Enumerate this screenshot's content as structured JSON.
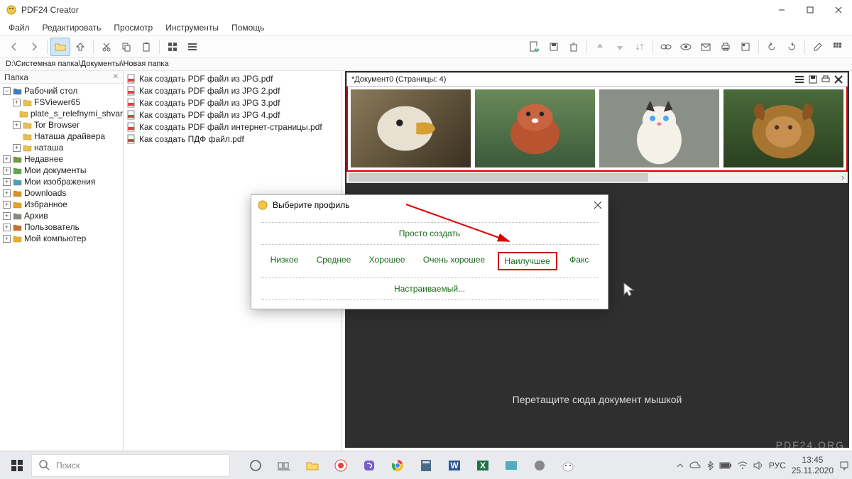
{
  "app": {
    "title": "PDF24 Creator"
  },
  "menu": {
    "file": "Файл",
    "edit": "Редактировать",
    "view": "Просмотр",
    "tools": "Инструменты",
    "help": "Помощь"
  },
  "path": "D:\\Системная папка\\Документы\\Новая папка",
  "left_pane": {
    "header": "Папка",
    "items": [
      {
        "label": "Рабочий стол",
        "expanded": true,
        "depth": 0,
        "icon": "desktop"
      },
      {
        "label": "FSViewer65",
        "expanded": false,
        "depth": 1,
        "icon": "folder"
      },
      {
        "label": "plate_s_relefnymi_shvar",
        "depth": 1,
        "icon": "folder",
        "leaf": true
      },
      {
        "label": "Tor Browser",
        "expanded": false,
        "depth": 1,
        "icon": "folder"
      },
      {
        "label": "Наташа драйвера",
        "depth": 1,
        "icon": "folder",
        "leaf": true
      },
      {
        "label": "наташа",
        "expanded": false,
        "depth": 1,
        "icon": "folder"
      },
      {
        "label": "Недавнее",
        "expanded": false,
        "depth": 0,
        "icon": "recent"
      },
      {
        "label": "Мои документы",
        "expanded": false,
        "depth": 0,
        "icon": "docs"
      },
      {
        "label": "Мои изображения",
        "expanded": false,
        "depth": 0,
        "icon": "images"
      },
      {
        "label": "Downloads",
        "expanded": false,
        "depth": 0,
        "icon": "downloads"
      },
      {
        "label": "Избранное",
        "expanded": false,
        "depth": 0,
        "icon": "favorites"
      },
      {
        "label": "Архив",
        "expanded": false,
        "depth": 0,
        "icon": "archive"
      },
      {
        "label": "Пользователь",
        "expanded": false,
        "depth": 0,
        "icon": "user"
      },
      {
        "label": "Мой компьютер",
        "expanded": false,
        "depth": 0,
        "icon": "computer"
      }
    ]
  },
  "files": [
    "Как создать PDF файл из JPG.pdf",
    "Как создать PDF файл из JPG 2.pdf",
    "Как создать PDF файл из JPG 3.pdf",
    "Как создать PDF файл из JPG 4.pdf",
    "Как создать PDF файл интернет-страницы.pdf",
    "Как создать ПДФ файл.pdf"
  ],
  "document": {
    "title": "*Документ0 (Страницы: 4)"
  },
  "drop_hint": "Перетащите сюда документ мышкой",
  "watermark": "PDF24.ORG",
  "dialog": {
    "title": "Выберите профиль",
    "simple": "Просто создать",
    "options": [
      "Низкое",
      "Среднее",
      "Хорошее",
      "Очень хорошее",
      "Наилучшее",
      "Факс"
    ],
    "highlighted_index": 4,
    "custom": "Настраиваемый..."
  },
  "taskbar": {
    "search_placeholder": "Поиск",
    "lang": "РУС",
    "time": "13:45",
    "date": "25.11.2020"
  }
}
